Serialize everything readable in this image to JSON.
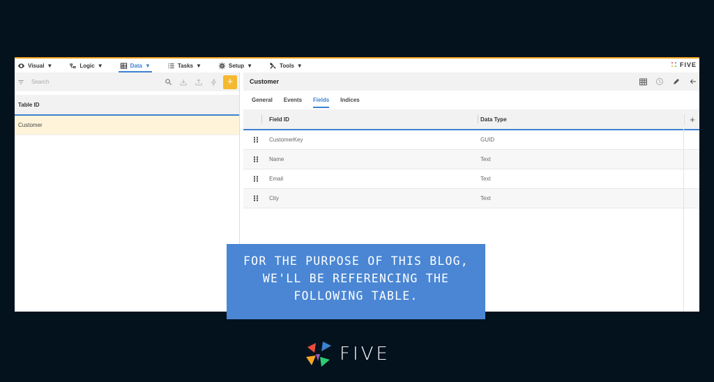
{
  "menu": {
    "items": [
      {
        "label": "Visual",
        "icon": "eye-icon"
      },
      {
        "label": "Logic",
        "icon": "logic-icon"
      },
      {
        "label": "Data",
        "icon": "table-icon",
        "active": true
      },
      {
        "label": "Tasks",
        "icon": "list-icon"
      },
      {
        "label": "Setup",
        "icon": "gear-icon"
      },
      {
        "label": "Tools",
        "icon": "tools-icon"
      }
    ],
    "arrow": "▼",
    "brand": "FIVE"
  },
  "left": {
    "search_placeholder": "Search",
    "column_header": "Table ID",
    "rows": [
      "Customer"
    ],
    "add_label": "+"
  },
  "right": {
    "title": "Customer",
    "tabs": [
      "General",
      "Events",
      "Fields",
      "Indices"
    ],
    "active_tab": "Fields",
    "columns": [
      "Field ID",
      "Data Type"
    ],
    "add_column_label": "+",
    "rows": [
      {
        "field": "CustomerKey",
        "type": "GUID"
      },
      {
        "field": "Name",
        "type": "Text"
      },
      {
        "field": "Email",
        "type": "Text"
      },
      {
        "field": "City",
        "type": "Text"
      }
    ]
  },
  "callout": {
    "lines": [
      "FOR THE PURPOSE OF THIS BLOG,",
      "WE'LL BE REFERENCING THE",
      "FOLLOWING TABLE."
    ]
  },
  "footer": {
    "brand": "FIVE"
  },
  "colors": {
    "background": "#04121e",
    "accent": "#3b82d0",
    "add_button": "#f5b82e",
    "callout": "#4a86d4",
    "selected_row": "#fff4da"
  }
}
